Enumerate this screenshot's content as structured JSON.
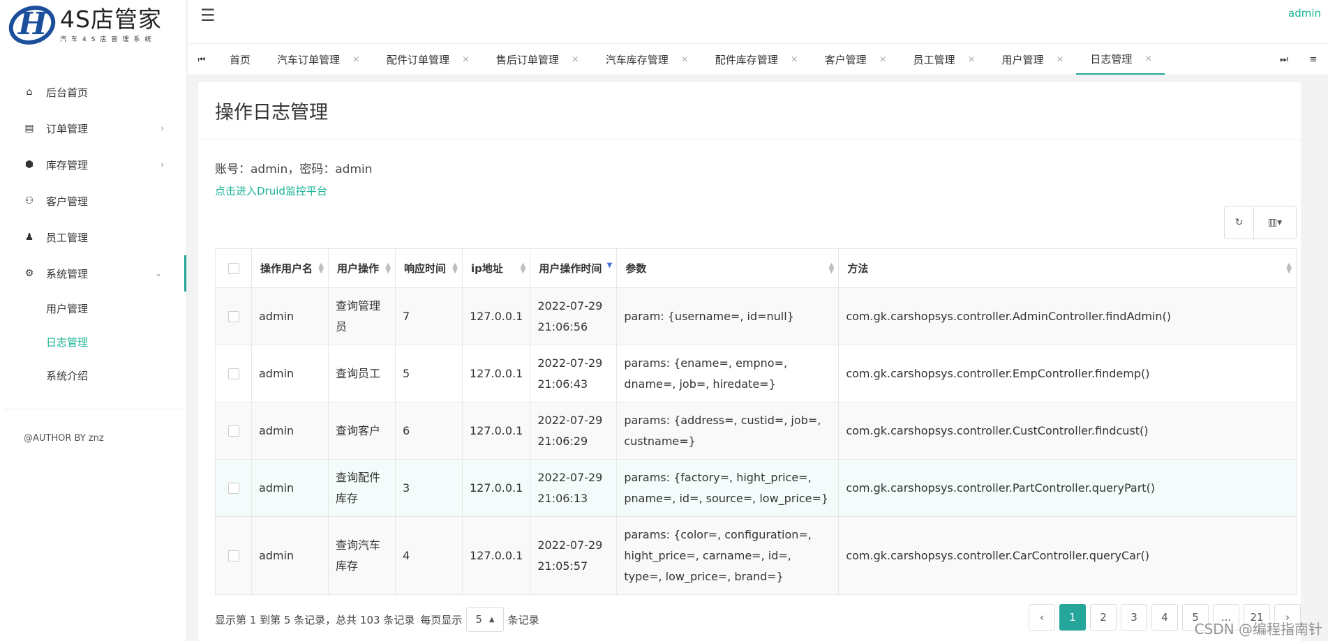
{
  "logo": {
    "title": "4S店管家",
    "subtitle": "汽车4S店管理系统",
    "mark": "H"
  },
  "sidebar": {
    "items": [
      {
        "label": "后台首页",
        "icon": "⌂"
      },
      {
        "label": "订单管理",
        "icon": "▤",
        "arrow": "›"
      },
      {
        "label": "库存管理",
        "icon": "⬢",
        "arrow": "›"
      },
      {
        "label": "客户管理",
        "icon": "⚇"
      },
      {
        "label": "员工管理",
        "icon": "♟"
      },
      {
        "label": "系统管理",
        "icon": "⚙",
        "arrow": "⌄"
      }
    ],
    "sub_items": [
      {
        "label": "用户管理"
      },
      {
        "label": "日志管理"
      },
      {
        "label": "系统介绍"
      }
    ],
    "author": "@AUTHOR BY znz"
  },
  "topbar": {
    "menu_icon": "☰",
    "user": "admin"
  },
  "tabs": {
    "prev": "⏮",
    "next": "⏭",
    "menu": "≡",
    "close": "×",
    "items": [
      "首页",
      "汽车订单管理",
      "配件订单管理",
      "售后订单管理",
      "汽车库存管理",
      "配件库存管理",
      "客户管理",
      "员工管理",
      "用户管理",
      "日志管理"
    ]
  },
  "page": {
    "title": "操作日志管理",
    "info": "账号：admin，密码：admin",
    "link": "点击进入Druid监控平台",
    "refresh_icon": "↻",
    "columns_icon": "▥▾"
  },
  "table": {
    "headers": [
      "操作用户名",
      "用户操作",
      "响应时间",
      "ip地址",
      "用户操作时间",
      "参数",
      "方法"
    ],
    "rows": [
      {
        "user": "admin",
        "op": "查询管理员",
        "time": "7",
        "ip": "127.0.0.1",
        "date": "2022-07-29 21:06:56",
        "params": "param: {username=, id=null}",
        "method": "com.gk.carshopsys.controller.AdminController.findAdmin()"
      },
      {
        "user": "admin",
        "op": "查询员工",
        "time": "5",
        "ip": "127.0.0.1",
        "date": "2022-07-29 21:06:43",
        "params": "params: {ename=, empno=, dname=, job=, hiredate=}",
        "method": "com.gk.carshopsys.controller.EmpController.findemp()"
      },
      {
        "user": "admin",
        "op": "查询客户",
        "time": "6",
        "ip": "127.0.0.1",
        "date": "2022-07-29 21:06:29",
        "params": "params: {address=, custid=, job=, custname=}",
        "method": "com.gk.carshopsys.controller.CustController.findcust()"
      },
      {
        "user": "admin",
        "op": "查询配件库存",
        "time": "3",
        "ip": "127.0.0.1",
        "date": "2022-07-29 21:06:13",
        "params": "params: {factory=, hight_price=, pname=, id=, source=, low_price=}",
        "method": "com.gk.carshopsys.controller.PartController.queryPart()"
      },
      {
        "user": "admin",
        "op": "查询汽车库存",
        "time": "4",
        "ip": "127.0.0.1",
        "date": "2022-07-29 21:05:57",
        "params": "params: {color=, configuration=, hight_price=, carname=, id=, type=, low_price=, brand=}",
        "method": "com.gk.carshopsys.controller.CarController.queryCar()"
      }
    ]
  },
  "footer": {
    "summary": "显示第 1 到第 5 条记录，总共 103 条记录",
    "per_page_label": "每页显示",
    "per_page_value": "5",
    "per_page_suffix": "条记录",
    "pages": [
      "‹",
      "1",
      "2",
      "3",
      "4",
      "5",
      "...",
      "21",
      "›"
    ],
    "active_page": "1"
  },
  "watermark": "CSDN @编程指南针",
  "colors": {
    "accent": "#26a69a",
    "link": "#1ab394",
    "logo": "#1b4f9c"
  }
}
